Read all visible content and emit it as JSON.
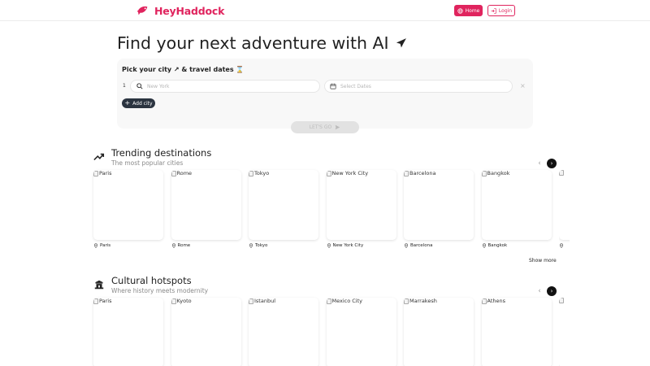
{
  "brand": {
    "name": "HeyHaddock",
    "color": "#e0245e"
  },
  "nav": {
    "home_label": "Home",
    "login_label": "Login"
  },
  "hero": {
    "title": "Find your next adventure with AI",
    "icon": "plane-icon"
  },
  "search": {
    "heading": "Pick your city ↗ & travel dates ⌛",
    "row_number": "1",
    "city_placeholder": "New York",
    "dates_placeholder": "Select Dates",
    "remove_label": "×",
    "add_city_label": "Add city",
    "go_label": "LET'S GO"
  },
  "trending": {
    "title": "Trending destinations",
    "subtitle": "The most popular cities",
    "icon": "trending-up-icon",
    "cities": [
      "Paris",
      "Rome",
      "Tokyo",
      "New York City",
      "Barcelona",
      "Bangkok"
    ],
    "show_more": "Show more"
  },
  "cultural": {
    "title": "Cultural hotspots",
    "subtitle": "Where history meets modernity",
    "icon": "temple-icon",
    "cities": [
      "Paris",
      "Kyoto",
      "Istanbul",
      "Mexico City",
      "Marrakesh",
      "Athens"
    ]
  }
}
